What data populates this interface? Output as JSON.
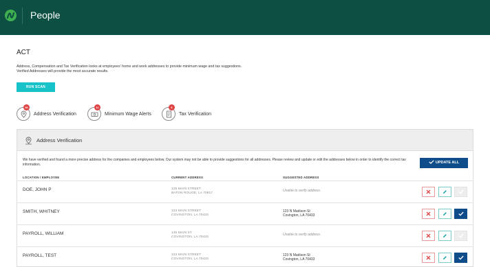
{
  "header": {
    "title": "People",
    "logo_icon": "nav-logo-icon",
    "bg_color": "#0d5043"
  },
  "page": {
    "title": "ACT",
    "description_line1": "Address, Compensation and Tax Verification looks at employees' home and work addresses to provide minimum wage and tax suggestions.",
    "description_line2": "Verified Addresses will provide the most accurate results.",
    "run_scan_label": "RUN SCAN"
  },
  "scans": [
    {
      "label": "Address Verification",
      "count": "36",
      "icon": "address-verification-icon"
    },
    {
      "label": "Minimum Wage Alerts",
      "count": "11",
      "icon": "minimum-wage-icon"
    },
    {
      "label": "Tax Verification",
      "count": "6",
      "icon": "tax-verification-icon"
    }
  ],
  "panel": {
    "title": "Address Verification",
    "note": "We have verified and found a more precise address for the companies and employees below. Our system may not be able to provide suggestions for all addresses. Please review and update or edit the addresses below in order to identify the correct tax information.",
    "update_all_label": "UPDATE ALL",
    "columns": {
      "location": "LOCATION / EMPLOYEE",
      "current": "CURRENT ADDRESS",
      "suggested": "SUGGESTED ADDRESS"
    },
    "rows": [
      {
        "name": "DOE, JOHN P",
        "current_line1": "125 MAIN STREET",
        "current_line2": "BATON ROUGE, LA 70817",
        "suggested_line1": "Unable to verify address.",
        "suggested_line2": "",
        "verified": false
      },
      {
        "name": "SMITH, WHITNEY",
        "current_line1": "123 MAIN STREET",
        "current_line2": "COVINGTON, LA 70433",
        "suggested_line1": "123 N Madison St",
        "suggested_line2": "Covington, LA 70433",
        "verified": true
      },
      {
        "name": "PAYROLL, WILLIAM",
        "current_line1": "145 MAIN ST",
        "current_line2": "COVINGTON, LA 70433",
        "suggested_line1": "Unable to verify address.",
        "suggested_line2": "",
        "verified": false
      },
      {
        "name": "PAYROLL, TEST",
        "current_line1": "123 MAIN STREET",
        "current_line2": "COVINGTON, LA 70433",
        "suggested_line1": "123 N Madison St",
        "suggested_line2": "Covington, LA 70433",
        "verified": true
      }
    ]
  },
  "colors": {
    "accent": "#17c3c9",
    "primary": "#0e4c8a",
    "badge": "#e04444",
    "reject": "#e04444",
    "edit": "#17a3a3"
  }
}
